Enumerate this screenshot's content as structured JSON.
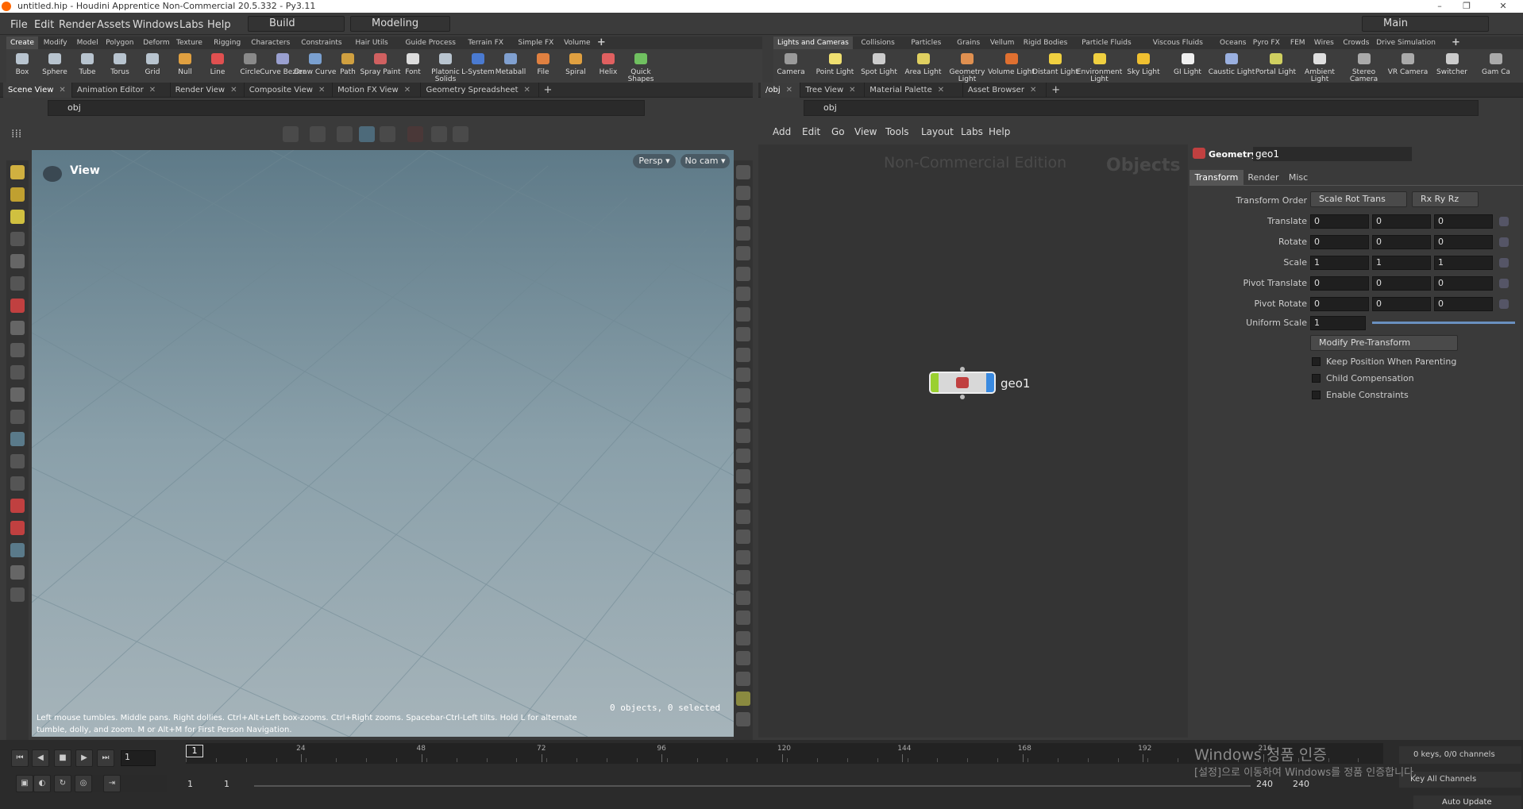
{
  "window": {
    "title": "untitled.hip - Houdini Apprentice Non-Commercial 20.5.332 - Py3.11",
    "controls": [
      "–",
      "❐",
      "✕"
    ]
  },
  "menu": {
    "items": [
      "File",
      "Edit",
      "Render",
      "Assets",
      "Windows",
      "Labs",
      "Help"
    ],
    "desktop": "Build",
    "context": "Modeling",
    "main": "Main"
  },
  "shelf_left": {
    "tabs": [
      "Create",
      "Modify",
      "Model",
      "Polygon",
      "Deform",
      "Texture",
      "Rigging",
      "Characters",
      "Constraints",
      "Hair Utils",
      "Guide Process",
      "Terrain FX",
      "Simple FX",
      "Volume"
    ],
    "tools": [
      {
        "label": "Box",
        "color": "#b8c4cf"
      },
      {
        "label": "Sphere",
        "color": "#b8c4cf"
      },
      {
        "label": "Tube",
        "color": "#b8c4cf"
      },
      {
        "label": "Torus",
        "color": "#b8c4cf"
      },
      {
        "label": "Grid",
        "color": "#b8c4cf"
      },
      {
        "label": "Null",
        "color": "#e0a040"
      },
      {
        "label": "Line",
        "color": "#e05050"
      },
      {
        "label": "Circle",
        "color": "#8a8a8a"
      },
      {
        "label": "Curve Bezier",
        "color": "#9aa0d0"
      },
      {
        "label": "Draw Curve",
        "color": "#7aa0d0"
      },
      {
        "label": "Path",
        "color": "#d0a040"
      },
      {
        "label": "Spray Paint",
        "color": "#d06060"
      },
      {
        "label": "Font",
        "color": "#dddddd"
      },
      {
        "label": "Platonic Solids",
        "color": "#b8c4cf"
      },
      {
        "label": "L-System",
        "color": "#4a7ad0"
      },
      {
        "label": "Metaball",
        "color": "#80a0d0"
      },
      {
        "label": "File",
        "color": "#e08040"
      },
      {
        "label": "Spiral",
        "color": "#e0a040"
      },
      {
        "label": "Helix",
        "color": "#e06060"
      },
      {
        "label": "Quick Shapes",
        "color": "#70c060"
      }
    ]
  },
  "shelf_right": {
    "tabs": [
      "Lights and Cameras",
      "Collisions",
      "Particles",
      "Grains",
      "Vellum",
      "Rigid Bodies",
      "Particle Fluids",
      "Viscous Fluids",
      "Oceans",
      "Pyro FX",
      "FEM",
      "Wires",
      "Crowds",
      "Drive Simulation"
    ],
    "tools": [
      {
        "label": "Camera",
        "color": "#9a9a9a"
      },
      {
        "label": "Point Light",
        "color": "#f0e070"
      },
      {
        "label": "Spot Light",
        "color": "#cccccc"
      },
      {
        "label": "Area Light",
        "color": "#e0d060"
      },
      {
        "label": "Geometry Light",
        "color": "#e09050"
      },
      {
        "label": "Volume Light",
        "color": "#e07030"
      },
      {
        "label": "Distant Light",
        "color": "#f0d040"
      },
      {
        "label": "Environment Light",
        "color": "#f0d040"
      },
      {
        "label": "Sky Light",
        "color": "#f0c030"
      },
      {
        "label": "GI Light",
        "color": "#f0f0f0"
      },
      {
        "label": "Caustic Light",
        "color": "#9ab0e0"
      },
      {
        "label": "Portal Light",
        "color": "#d0d060"
      },
      {
        "label": "Ambient Light",
        "color": "#e0e0e0"
      },
      {
        "label": "Stereo Camera",
        "color": "#aaaaaa"
      },
      {
        "label": "VR Camera",
        "color": "#aaaaaa"
      },
      {
        "label": "Switcher",
        "color": "#cccccc"
      },
      {
        "label": "Gam Ca",
        "color": "#aaaaaa"
      }
    ]
  },
  "left_panes": {
    "tabs": [
      "Scene View",
      "Animation Editor",
      "Render View",
      "Composite View",
      "Motion FX View",
      "Geometry Spreadsheet"
    ],
    "path": "obj"
  },
  "right_panes": {
    "tabs": [
      "/obj",
      "Tree View",
      "Material Palette",
      "Asset Browser"
    ],
    "path": "obj"
  },
  "viewport": {
    "label": "View",
    "persp": "Persp ▾",
    "cam": "No cam ▾",
    "status": "0 objects, 0 selected",
    "hint": "Left mouse tumbles. Middle pans. Right dollies. Ctrl+Alt+Left box-zooms. Ctrl+Right zooms. Spacebar-Ctrl-Left tilts. Hold L for alternate tumble, dolly, and zoom. M or Alt+M for First Person Navigation."
  },
  "network": {
    "menu": [
      "Add",
      "Edit",
      "Go",
      "View",
      "Tools",
      "Layout",
      "Labs",
      "Help"
    ],
    "watermark1": "Non-Commercial Edition",
    "watermark2": "Objects",
    "node": "geo1"
  },
  "params": {
    "type": "Geometry",
    "name": "geo1",
    "tabs": [
      "Transform",
      "Render",
      "Misc"
    ],
    "transform_order": "Scale Rot Trans",
    "rot_order": "Rx Ry Rz",
    "rows": [
      {
        "label": "Translate",
        "v": [
          "0",
          "0",
          "0"
        ]
      },
      {
        "label": "Rotate",
        "v": [
          "0",
          "0",
          "0"
        ]
      },
      {
        "label": "Scale",
        "v": [
          "1",
          "1",
          "1"
        ]
      },
      {
        "label": "Pivot Translate",
        "v": [
          "0",
          "0",
          "0"
        ]
      },
      {
        "label": "Pivot Rotate",
        "v": [
          "0",
          "0",
          "0"
        ]
      }
    ],
    "transform_order_label": "Transform Order",
    "uniform_label": "Uniform Scale",
    "uniform": "1",
    "uniform_fraction": 1.0,
    "modify": "Modify Pre-Transform",
    "checks": [
      "Keep Position When Parenting",
      "Child Compensation",
      "Enable Constraints"
    ]
  },
  "timeline": {
    "frame": "1",
    "ticks": [
      "24",
      "48",
      "72",
      "96",
      "120",
      "144",
      "168",
      "192",
      "216"
    ],
    "start": "1",
    "start2": "1",
    "end": "240",
    "end2": "240",
    "keys": "0 keys, 0/0 channels",
    "keyall": "Key All Channels",
    "autoupdate": "Auto Update",
    "activation1": "Windows 정품 인증",
    "activation2": "[설정]으로 이동하여 Windows를 정품 인증합니다."
  }
}
